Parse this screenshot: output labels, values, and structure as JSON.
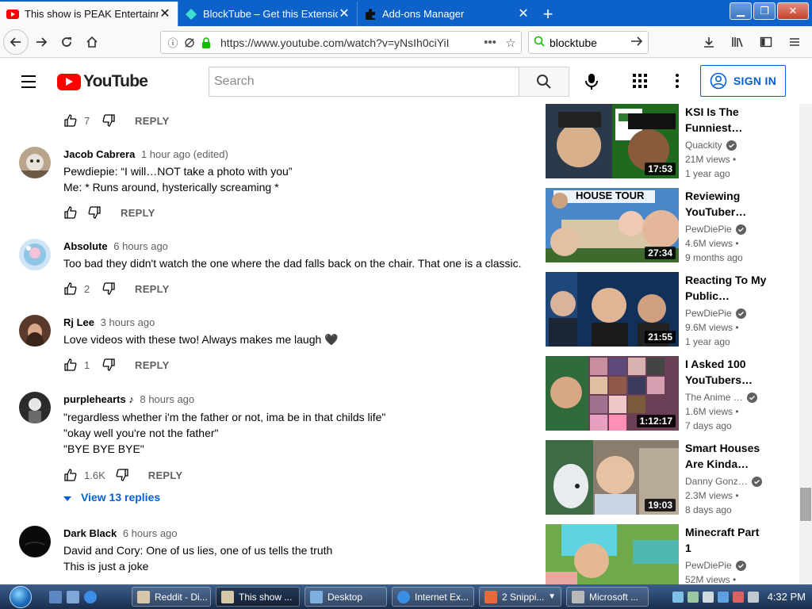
{
  "browser": {
    "tabs": [
      {
        "title": "This show is PEAK Entertainment",
        "active": true
      },
      {
        "title": "BlockTube – Get this Extension",
        "active": false
      },
      {
        "title": "Add-ons Manager",
        "active": false
      }
    ],
    "url": "https://www.youtube.com/watch?v=yNsIh0ciYiI",
    "search_value": "blocktube"
  },
  "yt": {
    "logo_text": "YouTube",
    "search_placeholder": "Search",
    "sign_in": "SIGN IN"
  },
  "comments": {
    "top_actions": {
      "likes": "7",
      "reply": "REPLY"
    },
    "items": [
      {
        "author": "Jacob Cabrera",
        "time": "1 hour ago (edited)",
        "lines": [
          "Pewdiepie: “I will…NOT take a photo with you”",
          "Me: * Runs around, hysterically screaming *"
        ],
        "likes": "",
        "reply": "REPLY"
      },
      {
        "author": "Absolute",
        "time": "6 hours ago",
        "lines": [
          "Too bad they didn't watch the one where the dad falls back on the chair. That one is a classic."
        ],
        "likes": "2",
        "reply": "REPLY"
      },
      {
        "author": "Rj Lee",
        "time": "3 hours ago",
        "lines": [
          "Love videos with these two! Always makes me laugh 🖤"
        ],
        "likes": "1",
        "reply": "REPLY"
      },
      {
        "author": "purplehearts ♪",
        "time": "8 hours ago",
        "lines": [
          "\"regardless whether i'm the father or not, ima be in that childs life\"",
          "\"okay well you're not the father\"",
          "\"BYE BYE BYE\""
        ],
        "likes": "1.6K",
        "reply": "REPLY",
        "view_replies": "View 13 replies"
      },
      {
        "author": "Dark Black",
        "time": "6 hours ago",
        "lines": [
          "David and Cory: One of us lies, one of us tells the truth",
          "This is just a joke"
        ],
        "likes": "",
        "reply": ""
      }
    ]
  },
  "recommended": [
    {
      "title_l1": "KSI Is The",
      "title_l2": "Funniest…",
      "channel": "Quackity",
      "views": "21M views •",
      "age": "1 year ago",
      "duration": "17:53"
    },
    {
      "title_l1": "Reviewing",
      "title_l2": "YouTuber…",
      "channel": "PewDiePie",
      "views": "4.6M views •",
      "age": "9 months ago",
      "duration": "27:34",
      "thumb_text": "HOUSE TOUR"
    },
    {
      "title_l1": "Reacting To My",
      "title_l2": "Public…",
      "channel": "PewDiePie",
      "views": "9.6M views •",
      "age": "1 year ago",
      "duration": "21:55"
    },
    {
      "title_l1": "I Asked 100",
      "title_l2": "YouTubers…",
      "channel": "The Anime …",
      "views": "1.6M views •",
      "age": "7 days ago",
      "duration": "1:12:17"
    },
    {
      "title_l1": "Smart Houses",
      "title_l2": "Are Kinda…",
      "channel": "Danny Gonz…",
      "views": "2.3M views •",
      "age": "8 days ago",
      "duration": "19:03"
    },
    {
      "title_l1": "Minecraft Part",
      "title_l2": "1",
      "channel": "PewDiePie",
      "views": "52M views •",
      "age": "",
      "duration": ""
    }
  ],
  "taskbar": {
    "buttons": [
      "Reddit - Di...",
      "This show ...",
      "Desktop",
      "Internet Ex...",
      "2 Snippi...",
      "Microsoft ..."
    ],
    "clock": "4:32 PM"
  },
  "colors": {
    "yt_red": "#ff0000",
    "link_blue": "#065fd4",
    "firefox_tab_blue": "#0c62c8"
  }
}
